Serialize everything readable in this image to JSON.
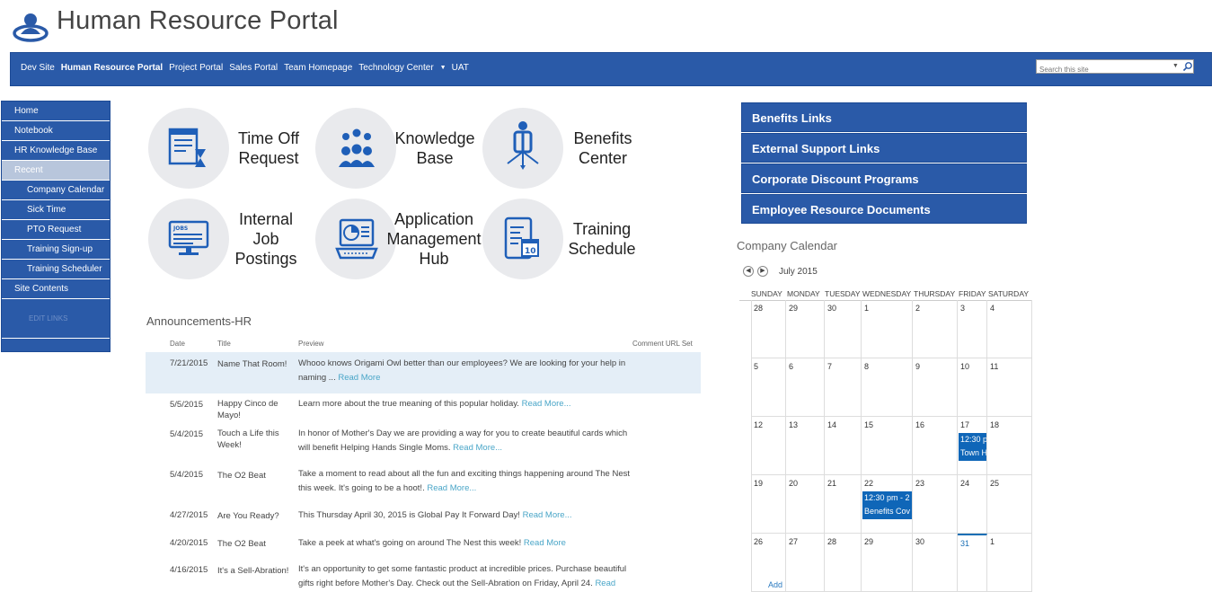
{
  "site": {
    "title": "Human Resource Portal"
  },
  "topnav": {
    "items": [
      "Dev Site",
      "Human Resource Portal",
      "Project Portal",
      "Sales Portal",
      "Team Homepage",
      "Technology Center",
      "UAT"
    ],
    "search_placeholder": "Search this site"
  },
  "leftnav": {
    "items": [
      "Home",
      "Notebook",
      "HR Knowledge Base",
      "Recent"
    ],
    "subitems": [
      "Company Calendar",
      "Sick Time",
      "PTO Request",
      "Training Sign-up",
      "Training Scheduler"
    ],
    "site_contents": "Site Contents",
    "edit_links": "EDIT LINKS"
  },
  "tiles": [
    {
      "label": "Time Off Request",
      "icon": "time-off-icon"
    },
    {
      "label": "Knowledge Base",
      "icon": "knowledge-base-icon"
    },
    {
      "label": "Benefits Center",
      "icon": "benefits-icon"
    },
    {
      "label": "Internal Job Postings",
      "icon": "jobs-monitor-icon"
    },
    {
      "label": "Application Management Hub",
      "icon": "laptop-chart-icon"
    },
    {
      "label": "Training Schedule",
      "icon": "tablet-calendar-icon"
    }
  ],
  "announcements": {
    "title": "Announcements-HR",
    "columns": [
      "Date",
      "Title",
      "Preview",
      "Comment URL Set"
    ],
    "rows": [
      {
        "date": "7/21/2015",
        "title": "Name That Room!",
        "preview": "Whooo knows Origami Owl better than our employees? We are looking for your help in naming ...",
        "more": "Read More"
      },
      {
        "date": "5/5/2015",
        "title": "Happy Cinco de Mayo!",
        "preview": "Learn more about the true meaning of this popular holiday.",
        "more": "Read More..."
      },
      {
        "date": "5/4/2015",
        "title": "Touch a Life this Week!",
        "preview": "In honor of Mother's Day we are providing a way for you to create beautiful cards which will benefit Helping Hands Single Moms.",
        "more": "Read More..."
      },
      {
        "date": "5/4/2015",
        "title": "The O2 Beat",
        "preview": "Take a moment to read about all the fun and exciting things happening around The Nest this week. It's going to be a hoot!.",
        "more": "Read More..."
      },
      {
        "date": "4/27/2015",
        "title": "Are You Ready?",
        "preview": "This Thursday April 30, 2015 is Global Pay It Forward Day!",
        "more": "Read More..."
      },
      {
        "date": "4/20/2015",
        "title": "The O2 Beat",
        "preview": "Take a peek at what's going on around The Nest this week!",
        "more": "Read More"
      },
      {
        "date": "4/16/2015",
        "title": "It's a Sell-Abration!",
        "preview": "It's an opportunity to get some fantastic product at incredible prices. Purchase beautiful gifts right before Mother's Day. Check out the Sell-Abration on Friday, April 24.",
        "more": "Read"
      }
    ]
  },
  "quick_links": [
    "Benefits Links",
    "External Support Links",
    "Corporate Discount Programs",
    "Employee Resource Documents"
  ],
  "calendar": {
    "title": "Company Calendar",
    "month": "July 2015",
    "days": [
      "SUNDAY",
      "MONDAY",
      "TUESDAY",
      "WEDNESDAY",
      "THURSDAY",
      "FRIDAY",
      "SATURDAY"
    ],
    "weeks": [
      [
        "28",
        "29",
        "30",
        "1",
        "2",
        "3",
        "4"
      ],
      [
        "5",
        "6",
        "7",
        "8",
        "9",
        "10",
        "11"
      ],
      [
        "12",
        "13",
        "14",
        "15",
        "16",
        "17",
        "18"
      ],
      [
        "19",
        "20",
        "21",
        "22",
        "23",
        "24",
        "25"
      ],
      [
        "26",
        "27",
        "28",
        "29",
        "30",
        "31",
        "1"
      ]
    ],
    "events": [
      {
        "line1": "12:30 p",
        "line2": "Town H"
      },
      {
        "line1": "12:30 pm - 2",
        "line2": "Benefits Cov"
      }
    ],
    "add": "Add"
  },
  "colors": {
    "nav_blue": "#2a5aa8",
    "event_blue": "#0f66b8",
    "link_teal": "#4aa6c8"
  }
}
